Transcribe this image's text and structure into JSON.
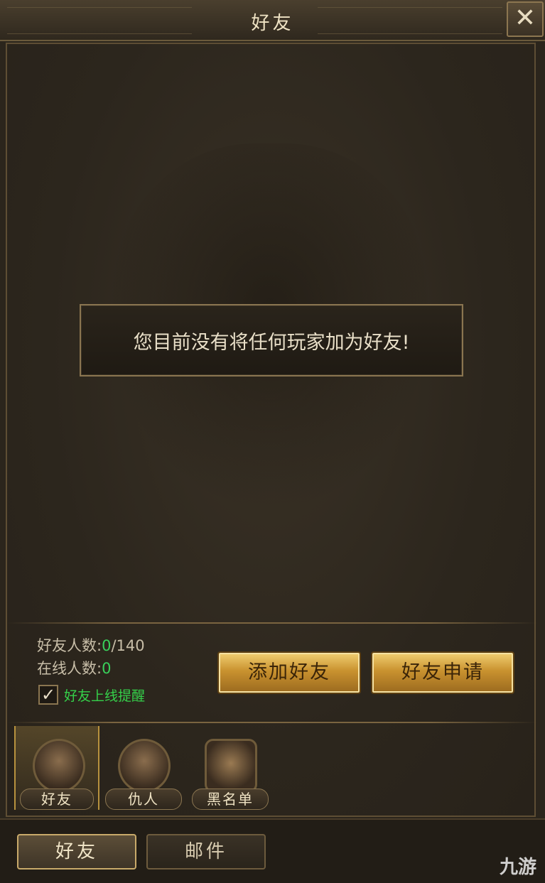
{
  "window": {
    "title": "好友",
    "close_icon": "close-icon"
  },
  "message": "您目前没有将任何玩家加为好友!",
  "stats": {
    "friend_count_label": "好友人数:",
    "friend_count_value": "0",
    "friend_count_total": "/140",
    "online_count_label": "在线人数:",
    "online_count_value": "0"
  },
  "online_reminder": {
    "label": "好友上线提醒",
    "checked": true
  },
  "buttons": {
    "add_friend": "添加好友",
    "friend_request": "好友申请"
  },
  "categories": [
    {
      "label": "好友",
      "active": true
    },
    {
      "label": "仇人",
      "active": false
    },
    {
      "label": "黑名单",
      "active": false
    }
  ],
  "bottom_tabs": [
    {
      "label": "好友",
      "active": true
    },
    {
      "label": "邮件",
      "active": false
    }
  ],
  "watermark": "九游",
  "colors": {
    "accent_gold": "#c9922f",
    "online_green": "#39d05a"
  }
}
